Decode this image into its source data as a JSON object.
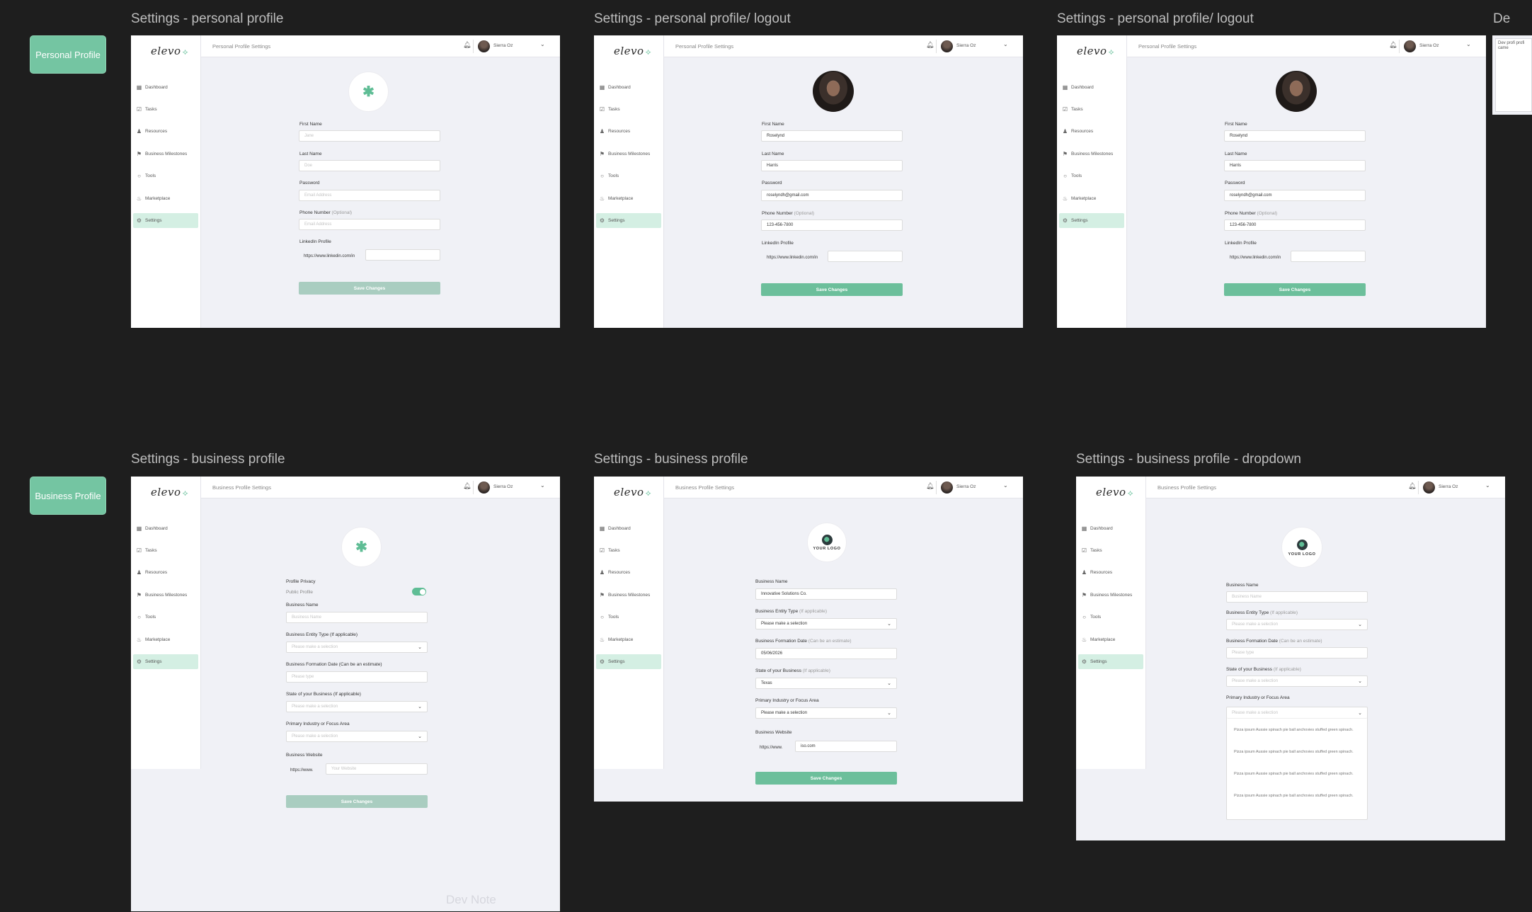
{
  "buttons": {
    "personal": "Personal Profile",
    "business": "Business Profile"
  },
  "frame_titles": [
    "Settings - personal profile",
    "Settings - personal profile/ logout",
    "Settings - personal profile/ logout",
    "Settings - business profile",
    "Settings - business profile",
    "Settings - business profile - dropdown",
    "De"
  ],
  "app": {
    "logo": "elevo",
    "user_name": "Sierra Oz",
    "nav": [
      "Dashboard",
      "Tasks",
      "Resources",
      "Business Milestones",
      "Tools",
      "Marketplace",
      "Settings"
    ],
    "personal_title": "Personal Profile Settings",
    "business_title": "Business Profile Settings"
  },
  "personal_form": {
    "first_name": "First Name",
    "last_name": "Last Name",
    "password": "Password",
    "phone": "Phone Number",
    "optional": "(Optional)",
    "linkedin": "LinkedIn Profile",
    "linkedin_prefix": "https://www.linkedin.com/in",
    "save": "Save Changes",
    "ph_first": "Jane",
    "ph_last": "Doe",
    "ph_password": "Email Address",
    "ph_phone": "Email Address",
    "val_first": "Roselynd",
    "val_last": "Harris",
    "val_password": "roselyndh@gmail.com",
    "val_phone": "123-456-7800"
  },
  "business_form": {
    "privacy": "Profile Privacy",
    "public": "Public Profile",
    "name": "Business Name",
    "entity": "Business Entity Type",
    "entity_hint": "(If applicable)",
    "formation": "Business Formation Date",
    "formation_hint": "(Can be an estimate)",
    "state": "State of your Business",
    "state_hint": "(If applicable)",
    "industry": "Primary Industry or Focus Area",
    "website": "Business Website",
    "website_prefix": "https://www.",
    "save": "Save Changes",
    "ph_name": "Business Name",
    "ph_select": "Please make a selection",
    "ph_date": "Please type",
    "ph_website": "Your Website",
    "val_name": "Innovative Solutions Co.",
    "val_date": "05/06/2026",
    "val_state": "Texas",
    "val_website": "iso.com",
    "logo_text": "YOUR LOGO"
  },
  "dropdown_items": [
    "Pizza ipsum Aussie spinach pie ball anchovies stuffed green spinach.",
    "Pizza ipsum Aussie spinach pie ball anchovies stuffed green spinach.",
    "Pizza ipsum Aussie spinach pie ball anchovies stuffed green spinach.",
    "Pizza ipsum Aussie spinach pie ball anchovies stuffed green spinach."
  ],
  "dev_note": "Dev Note",
  "partial_text": "Dev profi profi came"
}
